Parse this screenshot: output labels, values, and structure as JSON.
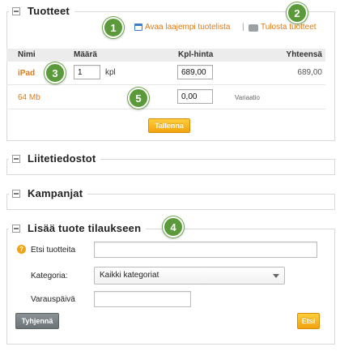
{
  "products": {
    "title": "Tuotteet",
    "open_list_link": "Avaa laajempi tuotelista",
    "separator": "|",
    "print_link": "Tulosta tuotteet",
    "columns": {
      "name": "Nimi",
      "quantity": "Määrä",
      "unit_price": "Kpl-hinta",
      "total": "Yhteensä"
    },
    "rows": [
      {
        "name": "iPad",
        "quantity": "1",
        "unit": "kpl",
        "unit_price": "689,00",
        "total": "689,00"
      },
      {
        "name": "64 Mb",
        "unit_price": "0,00",
        "note": "Variaatio"
      }
    ],
    "save_label": "Tallenna"
  },
  "attachments": {
    "title": "Liitetiedostot"
  },
  "campaigns": {
    "title": "Kampanjat"
  },
  "add_product": {
    "title": "Lisää tuote tilaukseen",
    "search_label": "Etsi tuotteita",
    "search_value": "",
    "category_label": "Kategoria:",
    "category_value": "Kaikki kategoriat",
    "date_label": "Varauspäivä",
    "date_value": "",
    "clear_label": "Tyhjennä",
    "search_button": "Etsi"
  },
  "callouts": [
    "1",
    "2",
    "3",
    "4",
    "5"
  ],
  "colors": {
    "accent": "#e07b15",
    "button": "#f2a30f",
    "badge": "#5a9a3a",
    "clear_button": "#6c7478"
  }
}
